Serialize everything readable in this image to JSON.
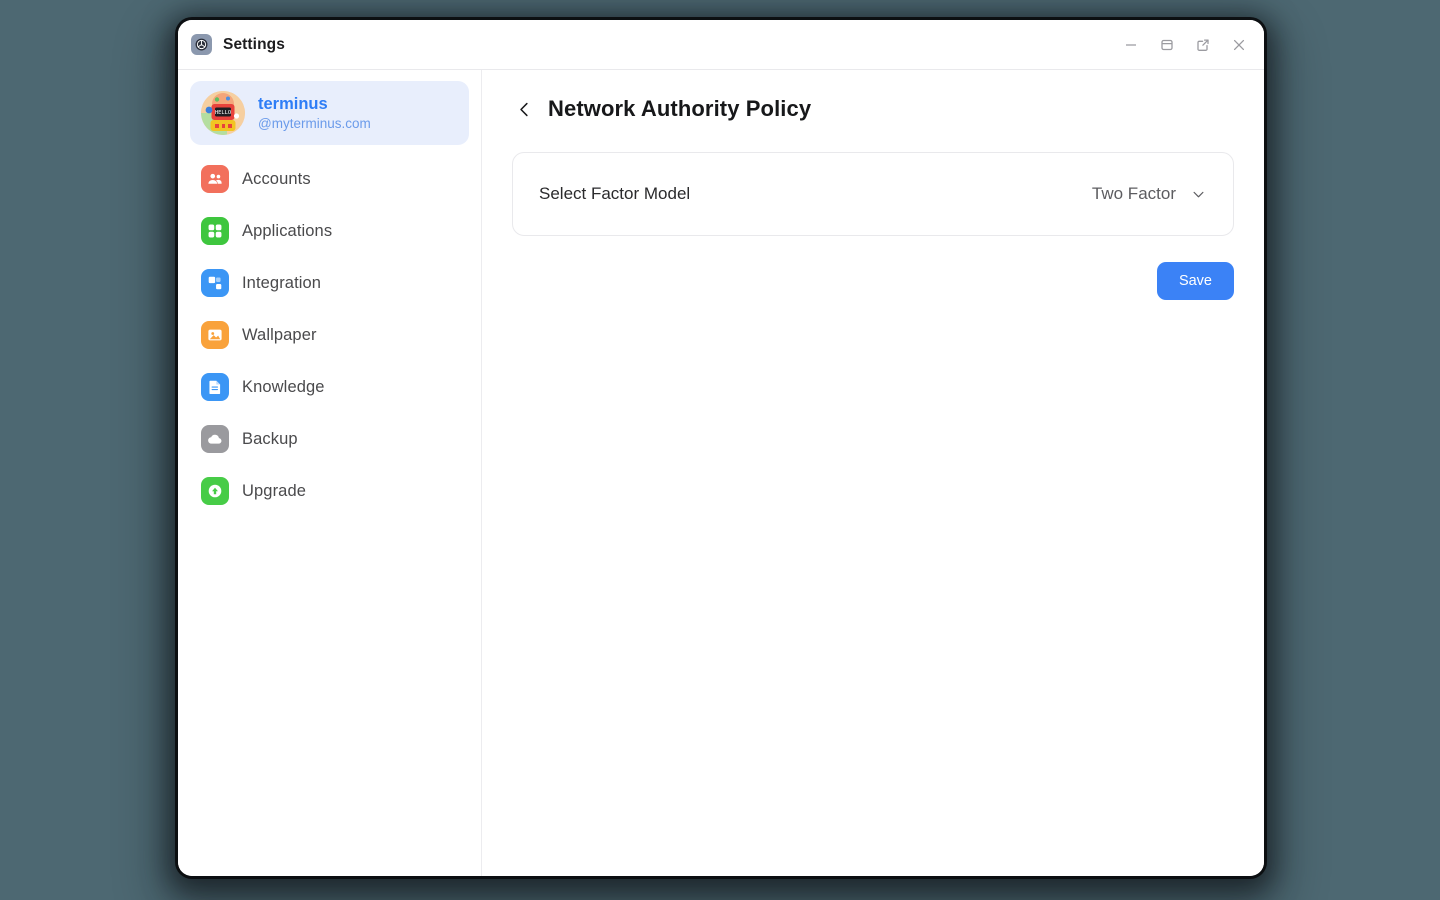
{
  "window": {
    "app_icon": "settings-gear-icon",
    "title": "Settings",
    "controls": [
      {
        "name": "minimize-button",
        "glyph": "minus"
      },
      {
        "name": "maximize-button",
        "glyph": "window"
      },
      {
        "name": "popout-button",
        "glyph": "external-link"
      },
      {
        "name": "close-button",
        "glyph": "cross"
      }
    ]
  },
  "sidebar": {
    "profile": {
      "avatar": "user-avatar-robot",
      "name": "terminus",
      "handle": "@myterminus.com",
      "selected": true
    },
    "items": [
      {
        "label": "Accounts",
        "icon": "accounts-icon",
        "color": "#f2705c"
      },
      {
        "label": "Applications",
        "icon": "applications-icon",
        "color": "#3ec63e"
      },
      {
        "label": "Integration",
        "icon": "integration-icon",
        "color": "#3b96f5"
      },
      {
        "label": "Wallpaper",
        "icon": "wallpaper-icon",
        "color": "#f9a23b"
      },
      {
        "label": "Knowledge",
        "icon": "knowledge-icon",
        "color": "#3b96f5"
      },
      {
        "label": "Backup",
        "icon": "backup-icon",
        "color": "#9a9a9e"
      },
      {
        "label": "Upgrade",
        "icon": "upgrade-icon",
        "color": "#47cc47"
      }
    ]
  },
  "main": {
    "back_icon": "chevron-left-icon",
    "title": "Network Authority Policy",
    "setting": {
      "label": "Select Factor Model",
      "value": "Two Factor",
      "chevron": "chevron-down-icon",
      "options": [
        "Two Factor"
      ]
    },
    "save_label": "Save"
  },
  "colors": {
    "desktop_background": "#4d6872",
    "accent": "#3b82f6",
    "profile_name": "#2e7df6",
    "profile_bg": "#e8eefc"
  }
}
